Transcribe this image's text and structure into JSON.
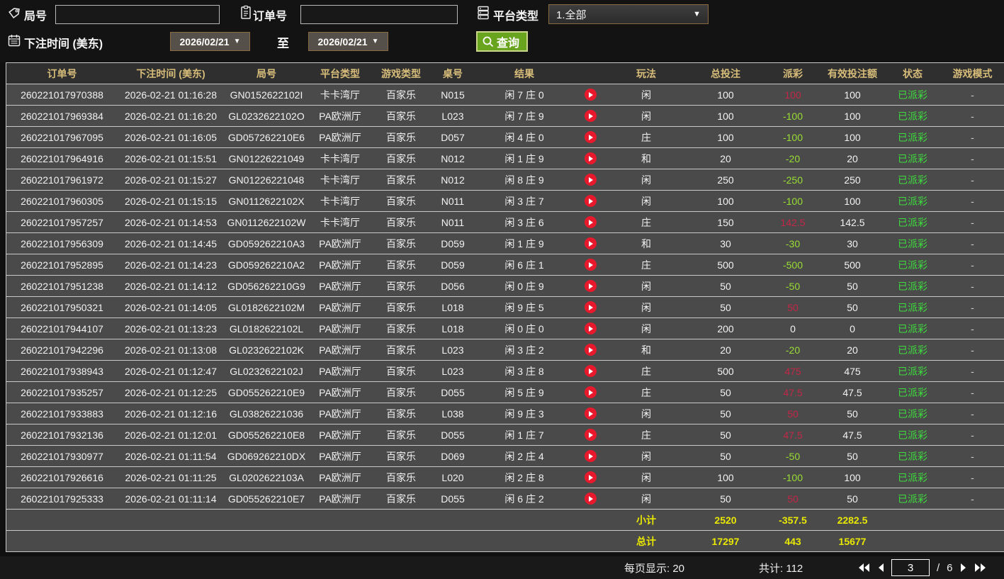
{
  "filters": {
    "round_label": "局号",
    "order_label": "订单号",
    "platform_label": "平台类型",
    "platform_value": "1.全部",
    "bet_time_label": "下注时间 (美东)",
    "date_from": "2026/02/21",
    "date_to": "2026/02/21",
    "to_label": "至",
    "search_label": "查询"
  },
  "colors": {
    "accent_gold_header": "#d8bd7a",
    "win_red": "#c22747",
    "loss_green": "#99dd33",
    "status_green": "#3ddd3d",
    "totals_yellow": "#e9e800",
    "search_green": "#69a41e"
  },
  "table": {
    "columns": [
      "订单号",
      "下注时间 (美东)",
      "局号",
      "平台类型",
      "游戏类型",
      "桌号",
      "结果",
      "玩法",
      "总投注",
      "派彩",
      "有效投注额",
      "状态",
      "游戏模式"
    ],
    "rows": [
      {
        "order": "260221017970388",
        "time": "2026-02-21 01:16:28",
        "round": "GN0152622102I",
        "platform": "卡卡湾厅",
        "game": "百家乐",
        "table": "N015",
        "result": "闲 7 庄 0",
        "play": "闲",
        "bet": "100",
        "payout": "100",
        "valid": "100",
        "status": "已派彩",
        "mode": "-"
      },
      {
        "order": "260221017969384",
        "time": "2026-02-21 01:16:20",
        "round": "GL0232622102O",
        "platform": "PA欧洲厅",
        "game": "百家乐",
        "table": "L023",
        "result": "闲 7 庄 9",
        "play": "闲",
        "bet": "100",
        "payout": "-100",
        "valid": "100",
        "status": "已派彩",
        "mode": "-"
      },
      {
        "order": "260221017967095",
        "time": "2026-02-21 01:16:05",
        "round": "GD057262210E6",
        "platform": "PA欧洲厅",
        "game": "百家乐",
        "table": "D057",
        "result": "闲 4 庄 0",
        "play": "庄",
        "bet": "100",
        "payout": "-100",
        "valid": "100",
        "status": "已派彩",
        "mode": "-"
      },
      {
        "order": "260221017964916",
        "time": "2026-02-21 01:15:51",
        "round": "GN01226221049",
        "platform": "卡卡湾厅",
        "game": "百家乐",
        "table": "N012",
        "result": "闲 1 庄 9",
        "play": "和",
        "bet": "20",
        "payout": "-20",
        "valid": "20",
        "status": "已派彩",
        "mode": "-"
      },
      {
        "order": "260221017961972",
        "time": "2026-02-21 01:15:27",
        "round": "GN01226221048",
        "platform": "卡卡湾厅",
        "game": "百家乐",
        "table": "N012",
        "result": "闲 8 庄 9",
        "play": "闲",
        "bet": "250",
        "payout": "-250",
        "valid": "250",
        "status": "已派彩",
        "mode": "-"
      },
      {
        "order": "260221017960305",
        "time": "2026-02-21 01:15:15",
        "round": "GN0112622102X",
        "platform": "卡卡湾厅",
        "game": "百家乐",
        "table": "N011",
        "result": "闲 3 庄 7",
        "play": "闲",
        "bet": "100",
        "payout": "-100",
        "valid": "100",
        "status": "已派彩",
        "mode": "-"
      },
      {
        "order": "260221017957257",
        "time": "2026-02-21 01:14:53",
        "round": "GN0112622102W",
        "platform": "卡卡湾厅",
        "game": "百家乐",
        "table": "N011",
        "result": "闲 3 庄 6",
        "play": "庄",
        "bet": "150",
        "payout": "142.5",
        "valid": "142.5",
        "status": "已派彩",
        "mode": "-"
      },
      {
        "order": "260221017956309",
        "time": "2026-02-21 01:14:45",
        "round": "GD059262210A3",
        "platform": "PA欧洲厅",
        "game": "百家乐",
        "table": "D059",
        "result": "闲 1 庄 9",
        "play": "和",
        "bet": "30",
        "payout": "-30",
        "valid": "30",
        "status": "已派彩",
        "mode": "-"
      },
      {
        "order": "260221017952895",
        "time": "2026-02-21 01:14:23",
        "round": "GD059262210A2",
        "platform": "PA欧洲厅",
        "game": "百家乐",
        "table": "D059",
        "result": "闲 6 庄 1",
        "play": "庄",
        "bet": "500",
        "payout": "-500",
        "valid": "500",
        "status": "已派彩",
        "mode": "-"
      },
      {
        "order": "260221017951238",
        "time": "2026-02-21 01:14:12",
        "round": "GD056262210G9",
        "platform": "PA欧洲厅",
        "game": "百家乐",
        "table": "D056",
        "result": "闲 0 庄 9",
        "play": "闲",
        "bet": "50",
        "payout": "-50",
        "valid": "50",
        "status": "已派彩",
        "mode": "-"
      },
      {
        "order": "260221017950321",
        "time": "2026-02-21 01:14:05",
        "round": "GL0182622102M",
        "platform": "PA欧洲厅",
        "game": "百家乐",
        "table": "L018",
        "result": "闲 9 庄 5",
        "play": "闲",
        "bet": "50",
        "payout": "50",
        "valid": "50",
        "status": "已派彩",
        "mode": "-"
      },
      {
        "order": "260221017944107",
        "time": "2026-02-21 01:13:23",
        "round": "GL0182622102L",
        "platform": "PA欧洲厅",
        "game": "百家乐",
        "table": "L018",
        "result": "闲 0 庄 0",
        "play": "闲",
        "bet": "200",
        "payout": "0",
        "valid": "0",
        "status": "已派彩",
        "mode": "-"
      },
      {
        "order": "260221017942296",
        "time": "2026-02-21 01:13:08",
        "round": "GL0232622102K",
        "platform": "PA欧洲厅",
        "game": "百家乐",
        "table": "L023",
        "result": "闲 3 庄 2",
        "play": "和",
        "bet": "20",
        "payout": "-20",
        "valid": "20",
        "status": "已派彩",
        "mode": "-"
      },
      {
        "order": "260221017938943",
        "time": "2026-02-21 01:12:47",
        "round": "GL0232622102J",
        "platform": "PA欧洲厅",
        "game": "百家乐",
        "table": "L023",
        "result": "闲 3 庄 8",
        "play": "庄",
        "bet": "500",
        "payout": "475",
        "valid": "475",
        "status": "已派彩",
        "mode": "-"
      },
      {
        "order": "260221017935257",
        "time": "2026-02-21 01:12:25",
        "round": "GD055262210E9",
        "platform": "PA欧洲厅",
        "game": "百家乐",
        "table": "D055",
        "result": "闲 5 庄 9",
        "play": "庄",
        "bet": "50",
        "payout": "47.5",
        "valid": "47.5",
        "status": "已派彩",
        "mode": "-"
      },
      {
        "order": "260221017933883",
        "time": "2026-02-21 01:12:16",
        "round": "GL03826221036",
        "platform": "PA欧洲厅",
        "game": "百家乐",
        "table": "L038",
        "result": "闲 9 庄 3",
        "play": "闲",
        "bet": "50",
        "payout": "50",
        "valid": "50",
        "status": "已派彩",
        "mode": "-"
      },
      {
        "order": "260221017932136",
        "time": "2026-02-21 01:12:01",
        "round": "GD055262210E8",
        "platform": "PA欧洲厅",
        "game": "百家乐",
        "table": "D055",
        "result": "闲 1 庄 7",
        "play": "庄",
        "bet": "50",
        "payout": "47.5",
        "valid": "47.5",
        "status": "已派彩",
        "mode": "-"
      },
      {
        "order": "260221017930977",
        "time": "2026-02-21 01:11:54",
        "round": "GD069262210DX",
        "platform": "PA欧洲厅",
        "game": "百家乐",
        "table": "D069",
        "result": "闲 2 庄 4",
        "play": "闲",
        "bet": "50",
        "payout": "-50",
        "valid": "50",
        "status": "已派彩",
        "mode": "-"
      },
      {
        "order": "260221017926616",
        "time": "2026-02-21 01:11:25",
        "round": "GL0202622103A",
        "platform": "PA欧洲厅",
        "game": "百家乐",
        "table": "L020",
        "result": "闲 2 庄 8",
        "play": "闲",
        "bet": "100",
        "payout": "-100",
        "valid": "100",
        "status": "已派彩",
        "mode": "-"
      },
      {
        "order": "260221017925333",
        "time": "2026-02-21 01:11:14",
        "round": "GD055262210E7",
        "platform": "PA欧洲厅",
        "game": "百家乐",
        "table": "D055",
        "result": "闲 6 庄 2",
        "play": "闲",
        "bet": "50",
        "payout": "50",
        "valid": "50",
        "status": "已派彩",
        "mode": "-"
      }
    ],
    "subtotal": {
      "label": "小计",
      "bet": "2520",
      "payout": "-357.5",
      "valid": "2282.5"
    },
    "total": {
      "label": "总计",
      "bet": "17297",
      "payout": "443",
      "valid": "15677"
    }
  },
  "pagination": {
    "per_page_label": "每页显示: 20",
    "total_label": "共计: 112",
    "current_page": "3",
    "page_separator": "/",
    "total_pages": "6"
  }
}
